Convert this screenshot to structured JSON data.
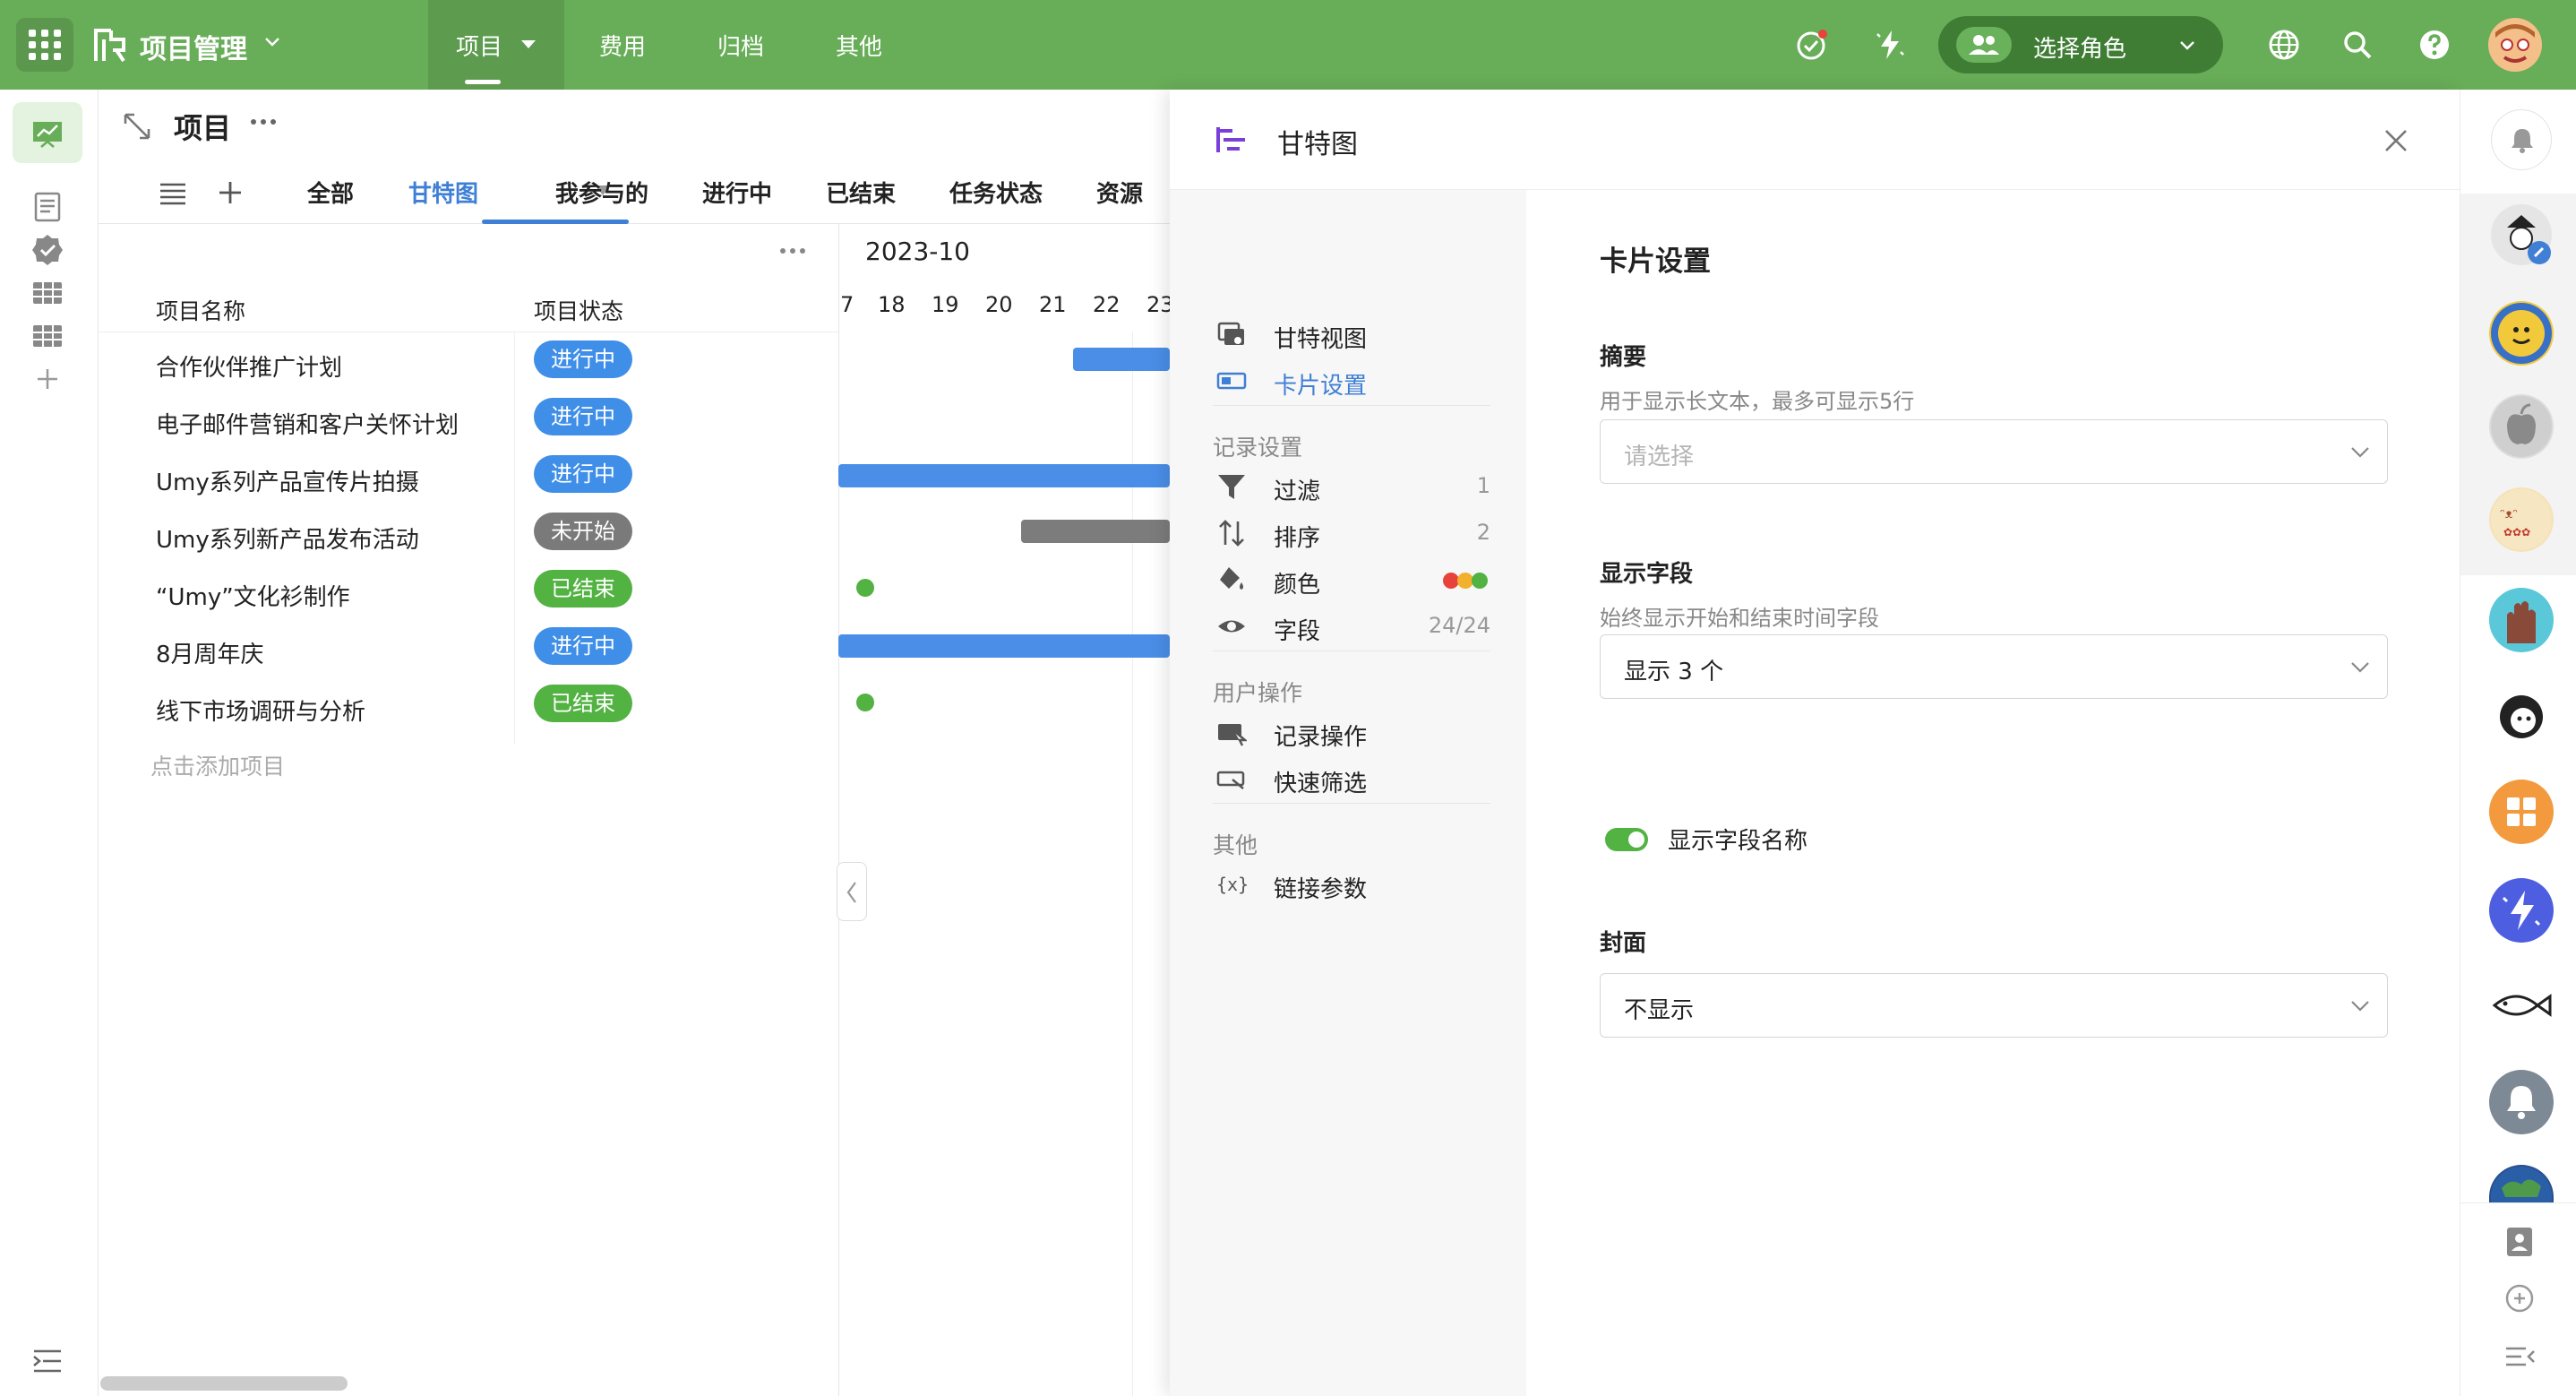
{
  "topbar": {
    "app_name": "项目管理",
    "nav": [
      "项目",
      "费用",
      "归档",
      "其他"
    ],
    "active_nav": "项目",
    "role_label": "选择角色",
    "accent": "#68ad58"
  },
  "project": {
    "title": "项目",
    "view_tabs": [
      "全部",
      "甘特图",
      "我参与的",
      "进行中",
      "已结束",
      "任务状态",
      "资源"
    ],
    "active_view": "甘特图"
  },
  "table": {
    "columns": [
      "项目名称",
      "项目状态"
    ],
    "rows": [
      {
        "name": "合作伙伴推广计划",
        "status": "进行中"
      },
      {
        "name": "电子邮件营销和客户关怀计划",
        "status": "进行中"
      },
      {
        "name": "Umy系列产品宣传片拍摄",
        "status": "进行中"
      },
      {
        "name": "Umy系列新产品发布活动",
        "status": "未开始"
      },
      {
        "name": "“Umy”文化衫制作",
        "status": "已结束"
      },
      {
        "name": "8月周年庆",
        "status": "进行中"
      },
      {
        "name": "线下市场调研与分析",
        "status": "已结束"
      }
    ],
    "add_row_label": "点击添加项目",
    "status_colors": {
      "进行中": "#3f8ee8",
      "未开始": "#7a7a7a",
      "已结束": "#52b242"
    }
  },
  "gantt": {
    "month": "2023-10",
    "days": [
      "7",
      "18",
      "19",
      "20",
      "21",
      "22",
      "23"
    ]
  },
  "panel": {
    "title": "甘特图",
    "menu_top": [
      {
        "label": "甘特视图",
        "icon": "gantt-view-icon"
      },
      {
        "label": "卡片设置",
        "icon": "card-icon"
      }
    ],
    "sections": {
      "record": {
        "title": "记录设置",
        "items": [
          {
            "label": "过滤",
            "count": "1",
            "icon": "filter-icon"
          },
          {
            "label": "排序",
            "count": "2",
            "icon": "sort-icon"
          },
          {
            "label": "颜色",
            "count": "",
            "icon": "paint-bucket-icon"
          },
          {
            "label": "字段",
            "count": "24/24",
            "icon": "eye-icon"
          }
        ]
      },
      "user": {
        "title": "用户操作",
        "items": [
          {
            "label": "记录操作",
            "icon": "record-action-icon"
          },
          {
            "label": "快速筛选",
            "icon": "quick-filter-icon"
          }
        ]
      },
      "other": {
        "title": "其他",
        "items": [
          {
            "label": "链接参数",
            "icon": "variable-icon"
          }
        ]
      }
    },
    "active_item": "卡片设置",
    "card_settings": {
      "title": "卡片设置",
      "summary": {
        "label": "摘要",
        "desc": "用于显示长文本，最多可显示5行",
        "placeholder": "请选择"
      },
      "fields": {
        "label": "显示字段",
        "desc": "始终显示开始和结束时间字段",
        "value": "显示 3 个",
        "toggle_label": "显示字段名称",
        "toggle_on": true
      },
      "cover": {
        "label": "封面",
        "value": "不显示"
      }
    }
  }
}
